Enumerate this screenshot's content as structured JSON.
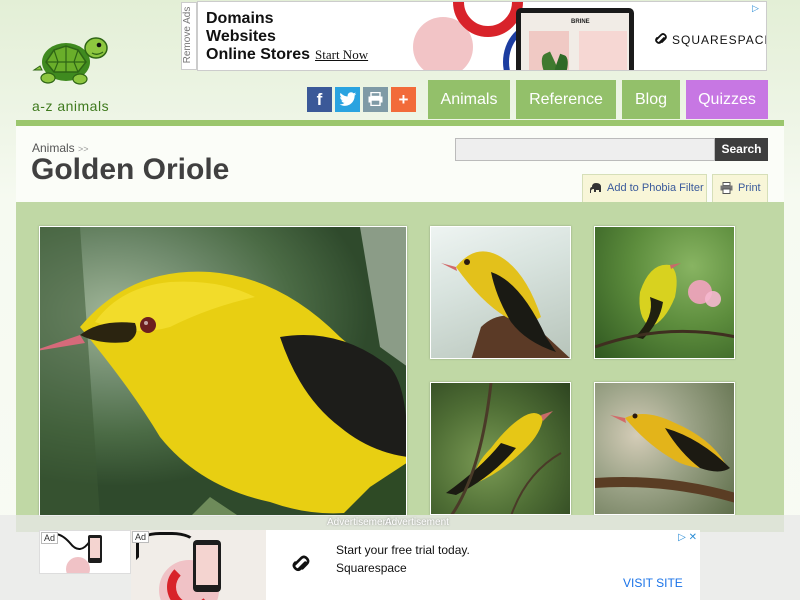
{
  "brand": {
    "logo_text": "a-z animals",
    "logo_icon": "turtle-icon",
    "accent": "#93c06a",
    "quiz_color": "#c777e3"
  },
  "ads": {
    "remove_ads": "Remove Ads",
    "top_banner": {
      "line1": "Domains",
      "line2": "Websites",
      "line3": "Online Stores",
      "cta": "Start Now",
      "screen_brand": "BRINE",
      "advertiser": "SQUARESPACE"
    },
    "label_1": "Advertisement",
    "label_2": "Advertisement",
    "small_tag": "Ad",
    "bottom_banner": {
      "tag": "Ad",
      "headline": "Start your free trial today.",
      "brand": "Squarespace",
      "cta": "VISIT SITE"
    }
  },
  "social": {
    "facebook": "f",
    "twitter": "twitter-icon",
    "print": "print-icon",
    "more": "+"
  },
  "nav": {
    "animals": "Animals",
    "reference": "Reference",
    "blog": "Blog",
    "quizzes": "Quizzes"
  },
  "breadcrumb": {
    "root": "Animals",
    "separator": ">>"
  },
  "page": {
    "title": "Golden Oriole"
  },
  "search": {
    "value": "",
    "button_label": "Search"
  },
  "tools": {
    "phobia_label": "Add to Phobia Filter",
    "print_label": "Print"
  },
  "gallery": {
    "photos": [
      "main-photo",
      "thumb-1",
      "thumb-2",
      "thumb-3",
      "thumb-4"
    ]
  }
}
